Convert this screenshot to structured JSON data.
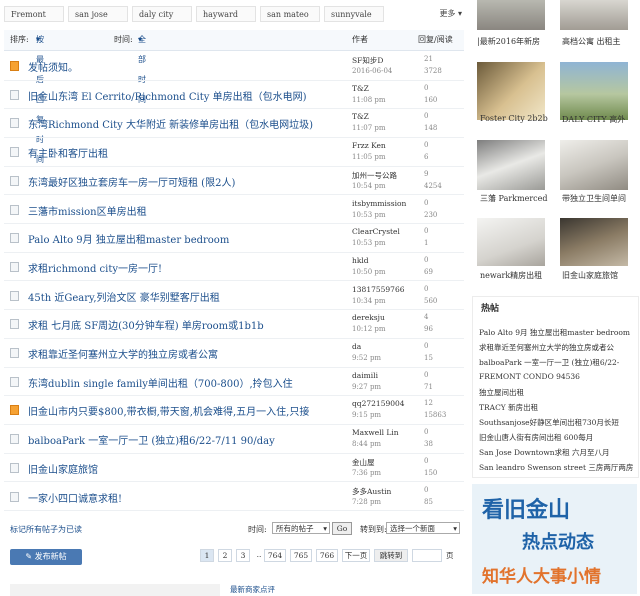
{
  "filters": [
    "Fremont",
    "san jose",
    "daly city",
    "hayward",
    "san mateo",
    "sunnyvale"
  ],
  "more_label": "更多",
  "header": {
    "sort_label": "排序:",
    "sort_value": "按最后回复时间",
    "time_label": "时间:",
    "time_value": "全部时间",
    "col_author": "作者",
    "col_replies": "回复/阅读"
  },
  "rows": [
    {
      "title": "发帖须知。",
      "author": "SF知步D",
      "time": "2016-06-04",
      "replies": "21",
      "views": "3728",
      "icon": "notice"
    },
    {
      "title": "旧金山东湾 El Cerrito/Richmond City 单房出租（包水电网)",
      "author": "T&Z",
      "time": "11:08 pm",
      "replies": "0",
      "views": "160",
      "icon": "normal"
    },
    {
      "title": "东湾Richmond City 大华附近 新装修单房出租（包水电网垃圾)",
      "author": "T&Z",
      "time": "11:07 pm",
      "replies": "0",
      "views": "148",
      "icon": "normal"
    },
    {
      "title": "有主卧和客厅出租",
      "author": "Frzz Ken",
      "time": "11:05 pm",
      "replies": "0",
      "views": "6",
      "icon": "normal"
    },
    {
      "title": "东湾最好区独立套房车一房一厅可短租 (限2人)",
      "author": "加州一号公路",
      "time": "10:54 pm",
      "replies": "9",
      "views": "4254",
      "icon": "normal"
    },
    {
      "title": "三藩市mission区单房出租",
      "author": "itsbymmission",
      "time": "10:53 pm",
      "replies": "0",
      "views": "230",
      "icon": "normal"
    },
    {
      "title": "Palo Alto 9月 独立屋出租master bedroom",
      "author": "ClearCrystel",
      "time": "10:53 pm",
      "replies": "0",
      "views": "1",
      "icon": "normal"
    },
    {
      "title": "求租richmond city一房一厅!",
      "author": "hkld",
      "time": "10:50 pm",
      "replies": "0",
      "views": "69",
      "icon": "normal"
    },
    {
      "title": "45th 近Geary,列治文区 豪华别墅客厅出租",
      "author": "13817559766",
      "time": "10:34 pm",
      "replies": "0",
      "views": "560",
      "icon": "normal"
    },
    {
      "title": "求租 七月底 SF周边(30分钟车程) 单房room或1b1b",
      "author": "dereksju",
      "time": "10:12 pm",
      "replies": "4",
      "views": "96",
      "icon": "normal"
    },
    {
      "title": "求租靠近圣何塞州立大学的独立房或者公寓",
      "author": "da",
      "time": "9:52 pm",
      "replies": "0",
      "views": "15",
      "icon": "normal"
    },
    {
      "title": "东湾dublin single family单间出租（700-800）,拎包入住",
      "author": "daimili",
      "time": "9:27 pm",
      "replies": "0",
      "views": "71",
      "icon": "normal"
    },
    {
      "title": "旧金山市内只要$800,带衣橱,带天窗,机会难得,五月一入住,只接",
      "author": "qq272159004",
      "time": "9:15 pm",
      "replies": "12",
      "views": "15863",
      "icon": "hot"
    },
    {
      "title": "balboaPark 一室一厅一卫 (独立)租6/22-7/11 90/day",
      "author": "Maxwell Lin",
      "time": "8:44 pm",
      "replies": "0",
      "views": "38",
      "icon": "normal"
    },
    {
      "title": "旧金山家庭旅馆",
      "author": "金山屋",
      "time": "7:36 pm",
      "replies": "0",
      "views": "150",
      "icon": "normal"
    },
    {
      "title": "一家小四口诚意求租!",
      "author": "多多Austin",
      "time": "7:28 pm",
      "replies": "0",
      "views": "85",
      "icon": "normal"
    }
  ],
  "bottom": {
    "mark_read": "标记所有帖子为已读",
    "time_label": "时间:",
    "time_select": "所有的帖子",
    "go": "Go",
    "jump_label": "转到到:",
    "jump_select": "选择一个新面",
    "post_button": "发布新帖",
    "pages": [
      "1",
      "2",
      "3",
      "..",
      "764",
      "765",
      "766"
    ],
    "next": "下一页",
    "goto_label": "跳转到",
    "page_unit": "页"
  },
  "right": {
    "top_caps": [
      "|最新2016年新房",
      "高档公寓 出租主"
    ],
    "thumbs": [
      {
        "caption": "Foster City 2b2b"
      },
      {
        "caption": "DALY CITY 高外"
      },
      {
        "caption": "三藩 Parkmerced"
      },
      {
        "caption": "带独立卫生间单间"
      },
      {
        "caption": "newark精房出租"
      },
      {
        "caption": "旧金山家庭旅馆"
      }
    ],
    "hot_title": "热帖",
    "hot_items": [
      "Palo Alto 9月 独立屋出租master bedroom",
      "求租靠近圣何塞州立大学的独立房或者公",
      "balboaPark 一室一厅一卫 (独立)租6/22-",
      "FREMONT CONDO 94536",
      "独立屋间出租",
      "TRACY 新房出租",
      "Southsanjose好静区单间出租730月长短",
      "旧金山唐人街有房间出租 600每月",
      "San Jose Downtown求租 六月至八月",
      "San leandro Swenson street 三房两厅两房"
    ],
    "ad_line1": "看旧金山",
    "ad_line2": "热点动态",
    "ad_line3": "知华人大事小情"
  },
  "footer_text": "最新商家点评"
}
